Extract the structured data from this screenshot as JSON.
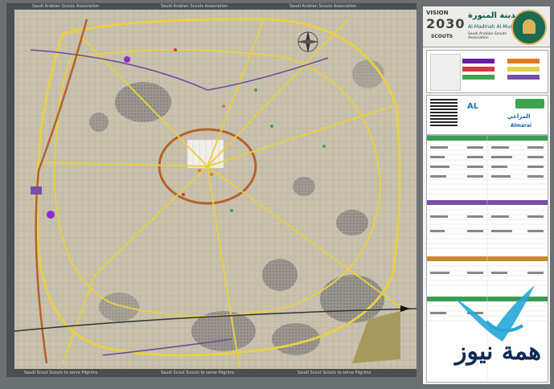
{
  "map": {
    "colors": {
      "land": "#c9c2ae",
      "dense": "#8f8c88",
      "road_main": "#e8cf47",
      "ring_road": "#b8612a",
      "purple_route": "#6a4ca0",
      "highway": "#f2e7a0"
    },
    "top_strip": [
      "Saudi Arabian Scouts Association",
      "Saudi Arabian Scouts Association",
      "Saudi Arabian Scouts Association"
    ],
    "bottom_strip": [
      "Saudi Scout Scouts to serve Pilgrims",
      "Saudi Scout Scouts to serve Pilgrims",
      "Saudi Scout Scouts to serve Pilgrims"
    ],
    "compass_icon": "compass-rose-icon"
  },
  "sidebar": {
    "vision": "VISION",
    "vision_year": "2030",
    "scouts": "SCOUTS",
    "title_ar": "المدينة المنورة",
    "title_en": "Al-Madinah Al-Munawarah",
    "subtitle": "Saudi Arabian Scouts Association",
    "emblem_icon": "madinah-emblem-icon",
    "legend_colors": [
      "#6b1fa0",
      "#d93838",
      "#3fa34d",
      "#e07b24",
      "#e8cf47",
      "#7a4ea8"
    ],
    "sponsors": {
      "sponsor_logos": [
        "AL",
        "المراعي",
        "Almarai"
      ],
      "qr_icon": "qr-code-icon"
    },
    "index_colors": {
      "header": "#3b9c56",
      "section1": "#7a4ea8",
      "section2": "#c98a2e",
      "section3": "#3b9c56"
    }
  },
  "watermark": {
    "text": "همة نيوز",
    "icon": "wave-logo-icon",
    "color": "#0e2b55",
    "accent": "#27a7d8"
  }
}
